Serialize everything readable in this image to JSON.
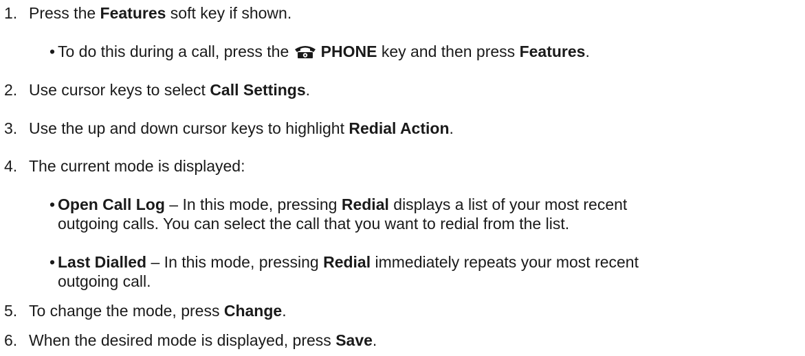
{
  "steps": [
    {
      "num": "1.",
      "pre": "Press the ",
      "bold": "Features",
      "post": " soft key if shown."
    },
    {
      "num": "2.",
      "pre": "Use cursor keys to select ",
      "bold": "Call Settings",
      "post": "."
    },
    {
      "num": "3.",
      "pre": "Use the up and down cursor keys to highlight ",
      "bold": "Redial Action",
      "post": "."
    },
    {
      "num": "4.",
      "pre": "The current mode is displayed:",
      "bold": "",
      "post": ""
    },
    {
      "num": "5.",
      "pre": "To change the mode, press ",
      "bold": "Change",
      "post": "."
    },
    {
      "num": "6.",
      "pre": "When the desired mode is displayed, press ",
      "bold": "Save",
      "post": "."
    }
  ],
  "sub1": {
    "bullet": "•",
    "pre": "To do this during a call, press the ",
    "icon": "phone-icon",
    "key_bold": "PHONE",
    "mid": " key and then press ",
    "bold2": "Features",
    "post": "."
  },
  "sub4a": {
    "bullet": "•",
    "bold": "Open Call Log",
    "mid": " – In this mode, pressing ",
    "bold2": "Redial",
    "post": " displays a list of your most recent",
    "cont": "outgoing calls. You can select the call that you want to redial from the list."
  },
  "sub4b": {
    "bullet": "•",
    "bold": "Last Dialled",
    "mid": " – In this mode, pressing ",
    "bold2": "Redial",
    "post": " immediately repeats your most recent",
    "cont": "outgoing call."
  }
}
